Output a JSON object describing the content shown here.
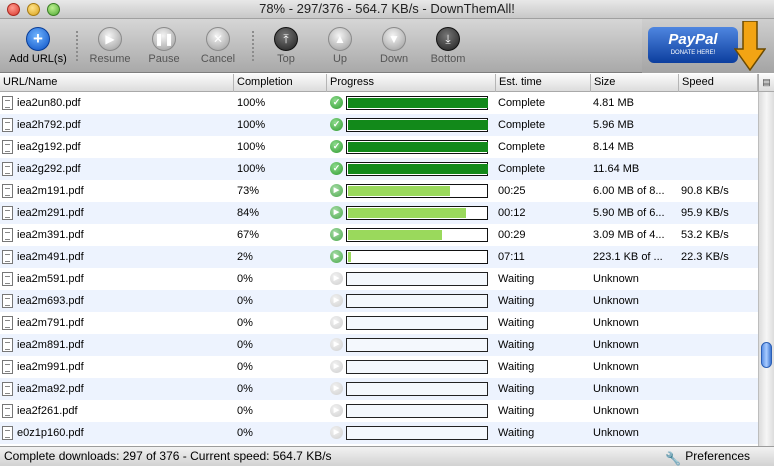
{
  "window": {
    "title": "78% - 297/376 - 564.7 KB/s - DownThemAll!"
  },
  "toolbar": {
    "buttons": [
      {
        "label": "Add URL(s)",
        "icon": "plus-icon",
        "glyph": "+"
      },
      {
        "label": "Resume",
        "icon": "play-icon",
        "glyph": "▶"
      },
      {
        "label": "Pause",
        "icon": "pause-icon",
        "glyph": "❚❚"
      },
      {
        "label": "Cancel",
        "icon": "cancel-icon",
        "glyph": "✕"
      },
      {
        "label": "Top",
        "icon": "move-top-icon",
        "glyph": "⤒"
      },
      {
        "label": "Up",
        "icon": "move-up-icon",
        "glyph": "▲"
      },
      {
        "label": "Down",
        "icon": "move-down-icon",
        "glyph": "▼"
      },
      {
        "label": "Bottom",
        "icon": "move-bottom-icon",
        "glyph": "⤓"
      }
    ]
  },
  "donate": {
    "logo": "PayPal",
    "caption": "DONATE HERE!",
    "icon": "download-arrow-icon",
    "arrow_color": "#f2a414"
  },
  "columns": [
    "URL/Name",
    "Completion",
    "Progress",
    "Est. time",
    "Size",
    "Speed"
  ],
  "colors": {
    "complete_fill": "#12891a",
    "running_fill": "#9ad95c",
    "row_alt": "#edf3fe"
  },
  "rows": [
    {
      "name": "iea2un80.pdf",
      "completion": "100%",
      "progress": 1.0,
      "state": "complete",
      "est_time": "Complete",
      "size": "4.81 MB",
      "speed": ""
    },
    {
      "name": "iea2h792.pdf",
      "completion": "100%",
      "progress": 1.0,
      "state": "complete",
      "est_time": "Complete",
      "size": "5.96 MB",
      "speed": ""
    },
    {
      "name": "iea2g192.pdf",
      "completion": "100%",
      "progress": 1.0,
      "state": "complete",
      "est_time": "Complete",
      "size": "8.14 MB",
      "speed": ""
    },
    {
      "name": "iea2g292.pdf",
      "completion": "100%",
      "progress": 1.0,
      "state": "complete",
      "est_time": "Complete",
      "size": "11.64 MB",
      "speed": ""
    },
    {
      "name": "iea2m191.pdf",
      "completion": "73%",
      "progress": 0.73,
      "state": "running",
      "est_time": "00:25",
      "size": "6.00 MB of 8...",
      "speed": "90.8 KB/s"
    },
    {
      "name": "iea2m291.pdf",
      "completion": "84%",
      "progress": 0.84,
      "state": "running",
      "est_time": "00:12",
      "size": "5.90 MB of 6...",
      "speed": "95.9 KB/s"
    },
    {
      "name": "iea2m391.pdf",
      "completion": "67%",
      "progress": 0.67,
      "state": "running",
      "est_time": "00:29",
      "size": "3.09 MB of 4...",
      "speed": "53.2 KB/s"
    },
    {
      "name": "iea2m491.pdf",
      "completion": "2%",
      "progress": 0.02,
      "state": "running",
      "est_time": "07:11",
      "size": "223.1 KB of ...",
      "speed": "22.3 KB/s"
    },
    {
      "name": "iea2m591.pdf",
      "completion": "0%",
      "progress": 0.0,
      "state": "waiting",
      "est_time": "Waiting",
      "size": "Unknown",
      "speed": ""
    },
    {
      "name": "iea2m693.pdf",
      "completion": "0%",
      "progress": 0.0,
      "state": "waiting",
      "est_time": "Waiting",
      "size": "Unknown",
      "speed": ""
    },
    {
      "name": "iea2m791.pdf",
      "completion": "0%",
      "progress": 0.0,
      "state": "waiting",
      "est_time": "Waiting",
      "size": "Unknown",
      "speed": ""
    },
    {
      "name": "iea2m891.pdf",
      "completion": "0%",
      "progress": 0.0,
      "state": "waiting",
      "est_time": "Waiting",
      "size": "Unknown",
      "speed": ""
    },
    {
      "name": "iea2m991.pdf",
      "completion": "0%",
      "progress": 0.0,
      "state": "waiting",
      "est_time": "Waiting",
      "size": "Unknown",
      "speed": ""
    },
    {
      "name": "iea2ma92.pdf",
      "completion": "0%",
      "progress": 0.0,
      "state": "waiting",
      "est_time": "Waiting",
      "size": "Unknown",
      "speed": ""
    },
    {
      "name": "iea2f261.pdf",
      "completion": "0%",
      "progress": 0.0,
      "state": "waiting",
      "est_time": "Waiting",
      "size": "Unknown",
      "speed": ""
    },
    {
      "name": "e0z1p160.pdf",
      "completion": "0%",
      "progress": 0.0,
      "state": "waiting",
      "est_time": "Waiting",
      "size": "Unknown",
      "speed": ""
    }
  ],
  "status": {
    "message": "Complete downloads: 297 of 376 - Current speed: 564.7 KB/s",
    "preferences_label": "Preferences",
    "preferences_icon": "wrench-icon"
  }
}
